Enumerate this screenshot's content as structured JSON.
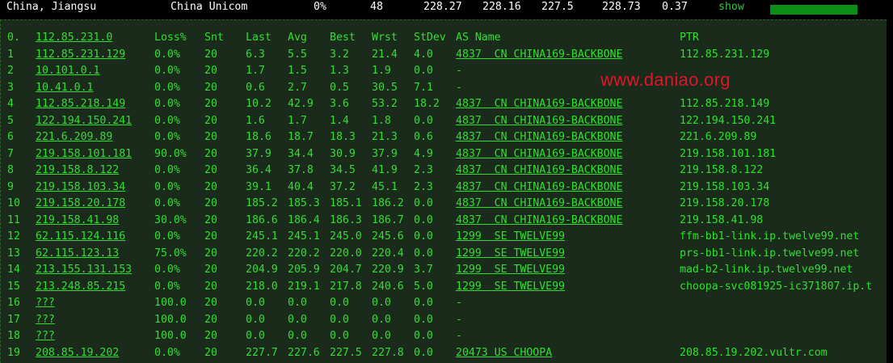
{
  "top": {
    "location": "China, Jiangsu",
    "isp": "China Unicom",
    "loss": "0%",
    "count": "48",
    "v1": "228.27",
    "v2": "228.16",
    "v3": "227.5",
    "v4": "228.73",
    "v5": "0.37",
    "show_label": "show"
  },
  "headers": [
    "0.",
    "112.85.231.0",
    "Loss%",
    "Snt",
    "Last",
    "Avg",
    "Best",
    "Wrst",
    "StDev",
    "AS Name",
    "PTR"
  ],
  "hops": [
    {
      "n": "1",
      "host": "112.85.231.129",
      "loss": "0.0%",
      "snt": "20",
      "last": "6.3",
      "avg": "5.5",
      "best": "3.2",
      "wrst": "21.4",
      "stdev": "4.0",
      "as": "4837  CN CHINA169-BACKBONE",
      "ptr": "112.85.231.129"
    },
    {
      "n": "2",
      "host": "10.101.0.1",
      "loss": "0.0%",
      "snt": "20",
      "last": "1.7",
      "avg": "1.5",
      "best": "1.3",
      "wrst": "1.9",
      "stdev": "0.0",
      "as": "-",
      "ptr": ""
    },
    {
      "n": "3",
      "host": "10.41.0.1",
      "loss": "0.0%",
      "snt": "20",
      "last": "0.6",
      "avg": "2.7",
      "best": "0.5",
      "wrst": "30.5",
      "stdev": "7.1",
      "as": "-",
      "ptr": ""
    },
    {
      "n": "4",
      "host": "112.85.218.149",
      "loss": "0.0%",
      "snt": "20",
      "last": "10.2",
      "avg": "42.9",
      "best": "3.6",
      "wrst": "53.2",
      "stdev": "18.2",
      "as": "4837  CN CHINA169-BACKBONE",
      "ptr": "112.85.218.149"
    },
    {
      "n": "5",
      "host": "122.194.150.241",
      "loss": "0.0%",
      "snt": "20",
      "last": "1.6",
      "avg": "1.7",
      "best": "1.4",
      "wrst": "1.8",
      "stdev": "0.0",
      "as": "4837  CN CHINA169-BACKBONE",
      "ptr": "122.194.150.241"
    },
    {
      "n": "6",
      "host": "221.6.209.89",
      "loss": "0.0%",
      "snt": "20",
      "last": "18.6",
      "avg": "18.7",
      "best": "18.3",
      "wrst": "21.3",
      "stdev": "0.6",
      "as": "4837  CN CHINA169-BACKBONE",
      "ptr": "221.6.209.89"
    },
    {
      "n": "7",
      "host": "219.158.101.181",
      "loss": "90.0%",
      "snt": "20",
      "last": "37.9",
      "avg": "34.4",
      "best": "30.9",
      "wrst": "37.9",
      "stdev": "4.9",
      "as": "4837  CN CHINA169-BACKBONE",
      "ptr": "219.158.101.181"
    },
    {
      "n": "8",
      "host": "219.158.8.122",
      "loss": "0.0%",
      "snt": "20",
      "last": "36.4",
      "avg": "37.8",
      "best": "34.5",
      "wrst": "41.9",
      "stdev": "2.3",
      "as": "4837  CN CHINA169-BACKBONE",
      "ptr": "219.158.8.122"
    },
    {
      "n": "9",
      "host": "219.158.103.34",
      "loss": "0.0%",
      "snt": "20",
      "last": "39.1",
      "avg": "40.4",
      "best": "37.2",
      "wrst": "45.1",
      "stdev": "2.3",
      "as": "4837  CN CHINA169-BACKBONE",
      "ptr": "219.158.103.34"
    },
    {
      "n": "10",
      "host": "219.158.20.178",
      "loss": "0.0%",
      "snt": "20",
      "last": "185.2",
      "avg": "185.3",
      "best": "185.1",
      "wrst": "186.2",
      "stdev": "0.0",
      "as": "4837  CN CHINA169-BACKBONE",
      "ptr": "219.158.20.178"
    },
    {
      "n": "11",
      "host": "219.158.41.98",
      "loss": "30.0%",
      "snt": "20",
      "last": "186.6",
      "avg": "186.4",
      "best": "186.3",
      "wrst": "186.7",
      "stdev": "0.0",
      "as": "4837  CN CHINA169-BACKBONE",
      "ptr": "219.158.41.98"
    },
    {
      "n": "12",
      "host": "62.115.124.116",
      "loss": "0.0%",
      "snt": "20",
      "last": "245.1",
      "avg": "245.1",
      "best": "245.0",
      "wrst": "245.6",
      "stdev": "0.0",
      "as": "1299  SE TWELVE99",
      "ptr": "ffm-bb1-link.ip.twelve99.net"
    },
    {
      "n": "13",
      "host": "62.115.123.13",
      "loss": "75.0%",
      "snt": "20",
      "last": "220.2",
      "avg": "220.2",
      "best": "220.0",
      "wrst": "220.4",
      "stdev": "0.0",
      "as": "1299  SE TWELVE99",
      "ptr": "prs-bb1-link.ip.twelve99.net"
    },
    {
      "n": "14",
      "host": "213.155.131.153",
      "loss": "0.0%",
      "snt": "20",
      "last": "204.9",
      "avg": "205.9",
      "best": "204.7",
      "wrst": "220.9",
      "stdev": "3.7",
      "as": "1299  SE TWELVE99",
      "ptr": "mad-b2-link.ip.twelve99.net"
    },
    {
      "n": "15",
      "host": "213.248.85.215",
      "loss": "0.0%",
      "snt": "20",
      "last": "218.0",
      "avg": "219.1",
      "best": "217.8",
      "wrst": "240.6",
      "stdev": "5.0",
      "as": "1299  SE TWELVE99",
      "ptr": "choopa-svc081925-ic371807.ip.t"
    },
    {
      "n": "16",
      "host": "???",
      "loss": "100.0",
      "snt": "20",
      "last": "0.0",
      "avg": "0.0",
      "best": "0.0",
      "wrst": "0.0",
      "stdev": "0.0",
      "as": "-",
      "ptr": ""
    },
    {
      "n": "17",
      "host": "???",
      "loss": "100.0",
      "snt": "20",
      "last": "0.0",
      "avg": "0.0",
      "best": "0.0",
      "wrst": "0.0",
      "stdev": "0.0",
      "as": "-",
      "ptr": ""
    },
    {
      "n": "18",
      "host": "???",
      "loss": "100.0",
      "snt": "20",
      "last": "0.0",
      "avg": "0.0",
      "best": "0.0",
      "wrst": "0.0",
      "stdev": "0.0",
      "as": "-",
      "ptr": ""
    },
    {
      "n": "19",
      "host": "208.85.19.202",
      "loss": "0.0%",
      "snt": "20",
      "last": "227.7",
      "avg": "227.6",
      "best": "227.5",
      "wrst": "227.8",
      "stdev": "0.0",
      "as": "20473 US CHOOPA",
      "ptr": "208.85.19.202.vultr.com"
    }
  ],
  "watermark": "www.daniao.org"
}
